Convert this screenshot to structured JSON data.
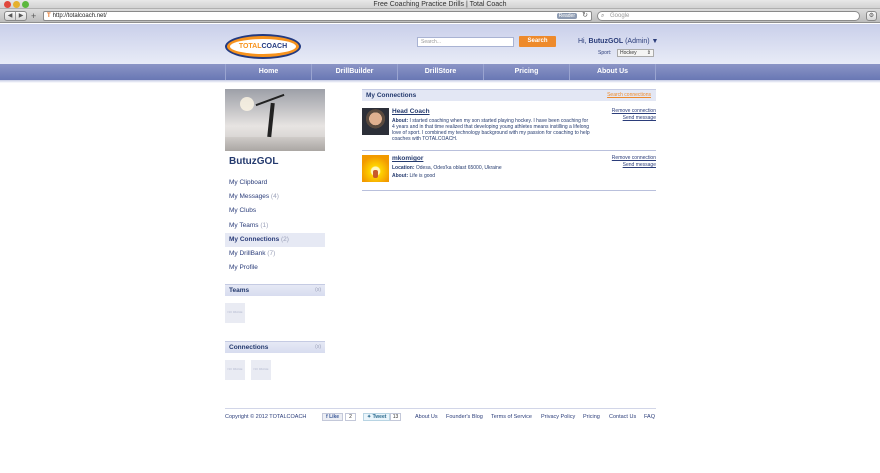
{
  "browser": {
    "window_title": "Free Coaching Practice Drills | Total Coach",
    "url": "http://totalcoach.net/",
    "reader_label": "Reader",
    "search_placeholder": "Google"
  },
  "header": {
    "logo_part1": "TOTAL",
    "logo_part2": "COACH",
    "search_placeholder": "Search...",
    "search_button": "Search",
    "greeting_prefix": "Hi,",
    "username": "ButuzGOL",
    "role": "(Admin) ▼",
    "sport_label": "Sport:",
    "sport_value": "Hockey",
    "sport_arrow": "⇕"
  },
  "nav": {
    "items": [
      {
        "label": "Home"
      },
      {
        "label": "DrillBuilder"
      },
      {
        "label": "DrillStore"
      },
      {
        "label": "Pricing"
      },
      {
        "label": "About Us"
      }
    ]
  },
  "sidebar": {
    "name": "ButuzGOL",
    "menu": [
      {
        "label": "My Clipboard",
        "count": ""
      },
      {
        "label": "My Messages",
        "count": "(4)"
      },
      {
        "label": "My Clubs",
        "count": ""
      },
      {
        "label": "My Teams",
        "count": "(1)"
      },
      {
        "label": "My Connections",
        "count": "(2)"
      },
      {
        "label": "My DrillBank",
        "count": "(7)"
      },
      {
        "label": "My Profile",
        "count": ""
      }
    ],
    "teams_title": "Teams",
    "connections_title": "Connections",
    "box_control": "(x)",
    "placeholder_text": "NO IMAGE"
  },
  "connections": {
    "title": "My Connections",
    "search_link": "Search connections",
    "entries": [
      {
        "name": "Head Coach",
        "about_label": "About:",
        "about": "I started coaching when my son started playing hockey. I have been coaching for 4 years and in that time realized that developing young athletes means instilling a lifelong love of sport. I combined my technology background with my passion for coaching to help coaches with TOTALCOACH.",
        "remove": "Remove connection",
        "message": "Send message"
      },
      {
        "name": "mkomigor",
        "location_label": "Location:",
        "location": "Odesa, Odes'ka oblast 65000, Ukraine",
        "about_label": "About:",
        "about": "Life is good",
        "remove": "Remove connection",
        "message": "Send message"
      }
    ]
  },
  "footer": {
    "copyright": "Copyright © 2012 TOTALCOACH",
    "like_label": "Like",
    "like_count": "2",
    "tweet_label": "Tweet",
    "tweet_count": "13",
    "links": [
      {
        "label": "About Us"
      },
      {
        "label": "Founder's Blog"
      },
      {
        "label": "Terms of Service"
      },
      {
        "label": "Privacy Policy"
      },
      {
        "label": "Pricing"
      },
      {
        "label": "Contact Us"
      },
      {
        "label": "FAQ"
      }
    ]
  },
  "colors": {
    "accent_orange": "#ee8a2b",
    "brand_navy": "#243a6e",
    "nav_blue": "#6977b4"
  }
}
